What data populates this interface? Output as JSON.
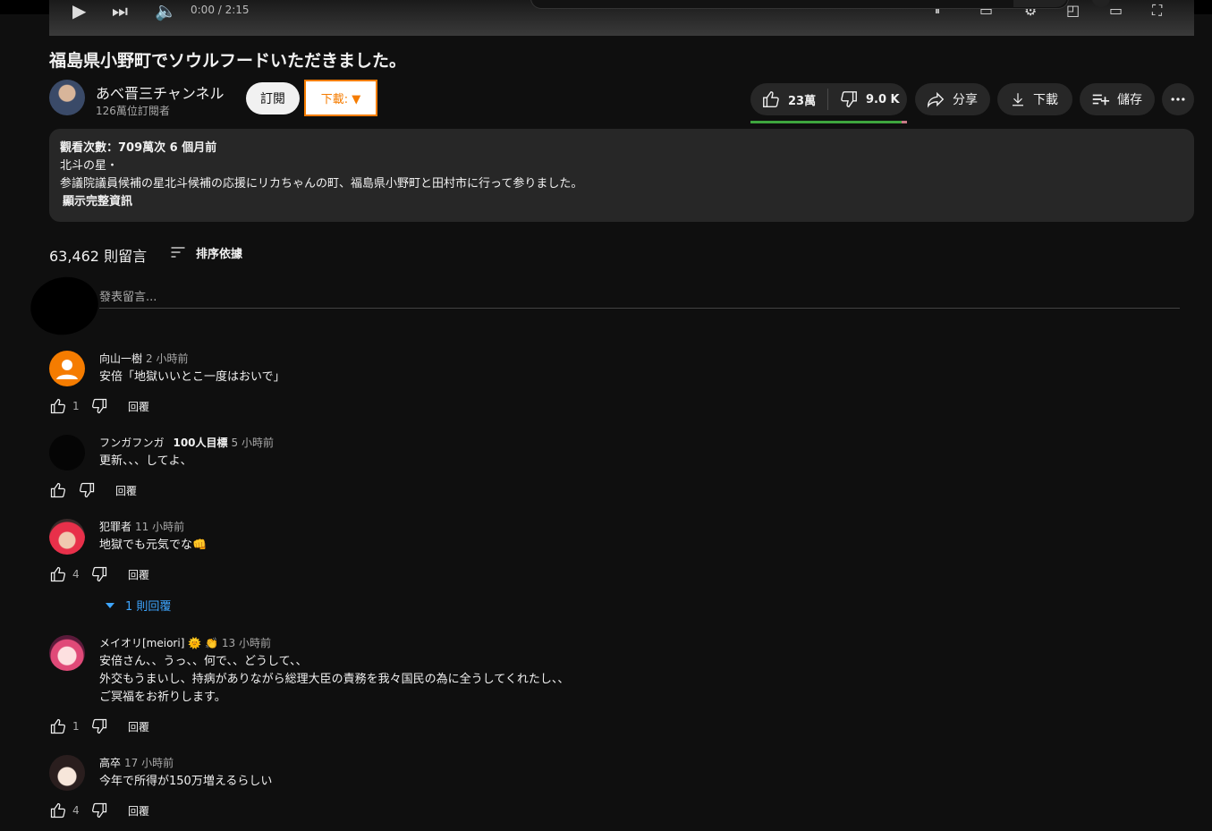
{
  "player": {
    "time": "0:00 / 2:15"
  },
  "video": {
    "title": "福島県小野町でソウルフードいただきました。"
  },
  "channel": {
    "name": "あべ晋三チャンネル",
    "subscribers": "126萬位訂閱者",
    "subscribe_label": "訂閱"
  },
  "extension_download": {
    "label": "下載: ▼",
    "border_color": "#f57c00"
  },
  "actions": {
    "likes": "23萬",
    "dislikes": "9.0 K",
    "share": "分享",
    "download": "下載",
    "save": "儲存"
  },
  "description": {
    "stats": "觀看次數：709萬次  6 個月前",
    "line1": "北斗の星・",
    "line2": "参議院議員候補の星北斗候補の応援にリカちゃんの町、福島県小野町と田村市に行って参りました。",
    "more": "顯示完整資訊"
  },
  "comments_header": {
    "count": "63,462 則留言",
    "sort": "排序依據",
    "placeholder": "發表留言..."
  },
  "comments": [
    {
      "author": "向山一樹",
      "time": "2 小時前",
      "text": [
        "安倍「地獄いいとこ一度はおいで」"
      ],
      "likes": "1",
      "reply": "回覆"
    },
    {
      "author": "フンガフンガ",
      "badge": "100人目標",
      "time": "5 小時前",
      "text": [
        "更新、、、してよ、"
      ],
      "likes": "",
      "reply": "回覆"
    },
    {
      "author": "犯罪者",
      "time": "11 小時前",
      "text": [
        "地獄でも元気でな👊"
      ],
      "likes": "4",
      "reply": "回覆",
      "replies": "1 則回覆"
    },
    {
      "author": "メイオリ[meiori] 🌞 👏",
      "time": "13 小時前",
      "text": [
        "安倍さん、、うっ、、何で、、どうして、、",
        "外交もうまいし、持病がありながら総理大臣の責務を我々国民の為に全うしてくれたし、、",
        "ご冥福をお祈りします。"
      ],
      "likes": "1",
      "reply": "回覆"
    },
    {
      "author": "高卒",
      "time": "17 小時前",
      "text": [
        "今年で所得が150万増えるらしい"
      ],
      "likes": "4",
      "reply": "回覆"
    }
  ],
  "colors": {
    "background": "#0f0f0f",
    "surface": "#272727",
    "like_bar": "#3ea63e",
    "link": "#3ea6ff"
  }
}
